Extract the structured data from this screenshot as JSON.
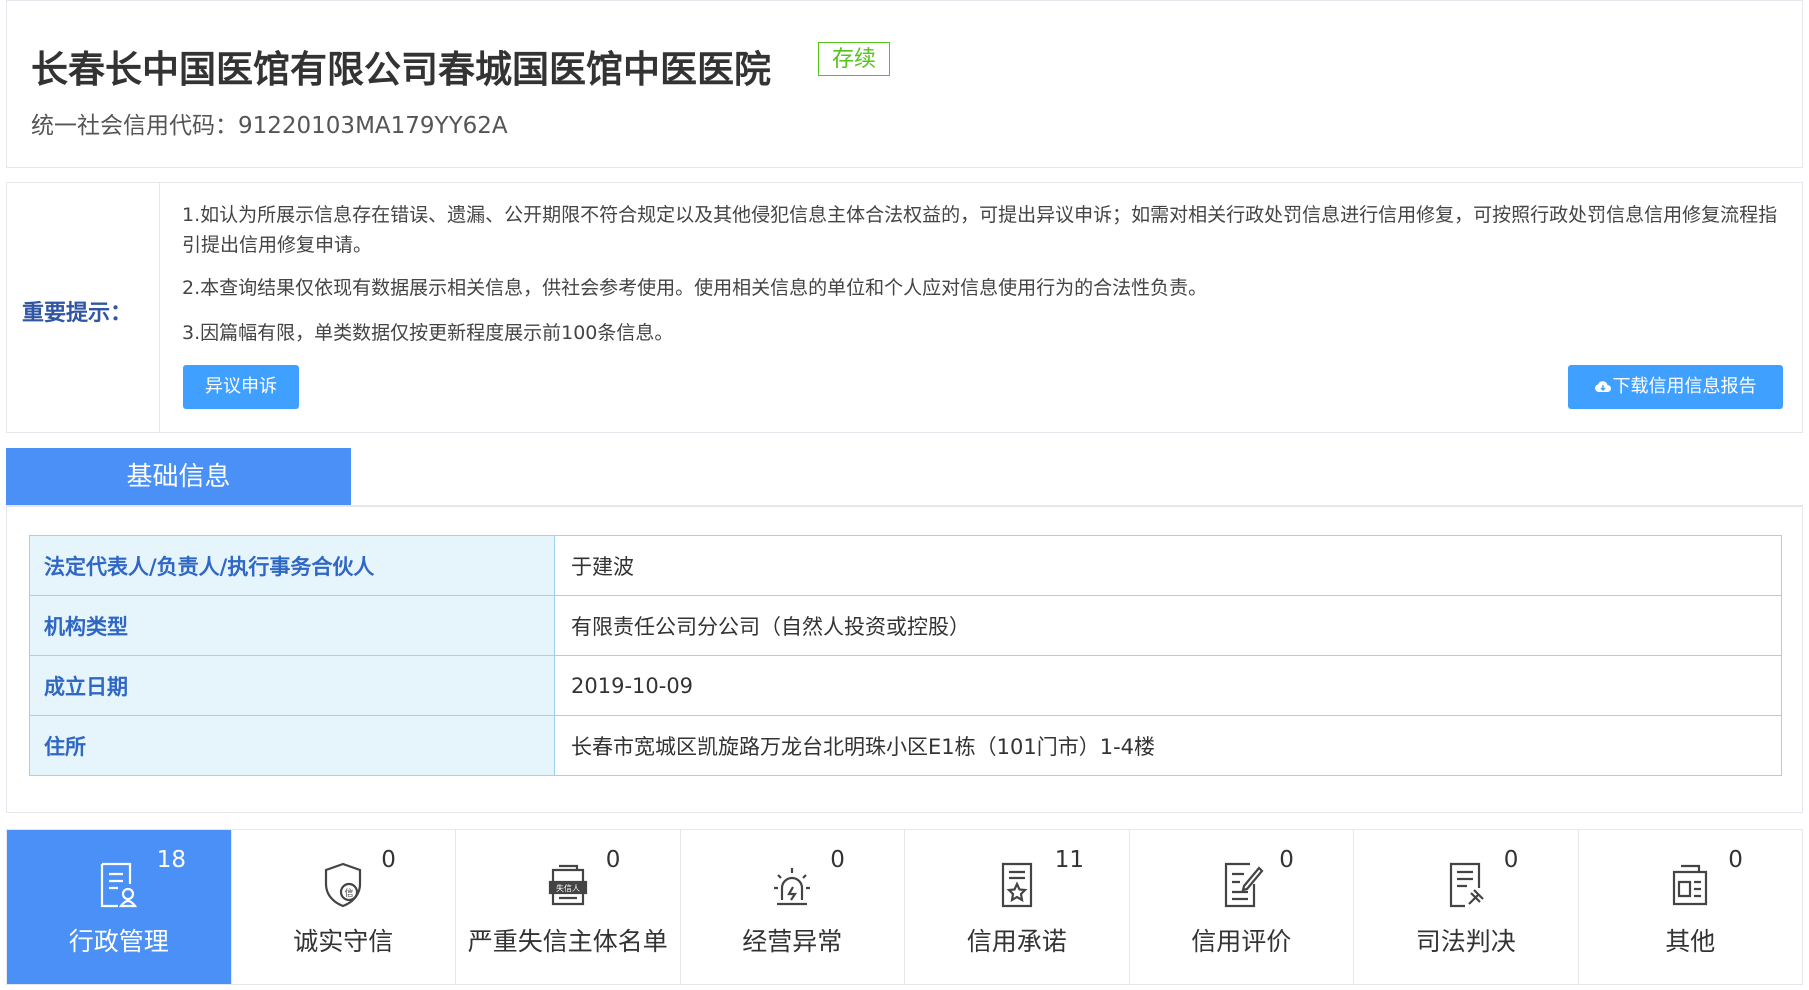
{
  "header": {
    "company_name": "长春长中国医馆有限公司春城国医馆中医医院",
    "status_badge": "存续",
    "credit_code_label": "统一社会信用代码：91220103MA179YY62A"
  },
  "notice": {
    "label": "重要提示：",
    "line1": "1.如认为所展示信息存在错误、遗漏、公开期限不符合规定以及其他侵犯信息主体合法权益的，可提出异议申诉；如需对相关行政处罚信息进行信用修复，可按照行政处罚信息信用修复流程指引提出信用修复申请。",
    "line2": "2.本查询结果仅依现有数据展示相关信息，供社会参考使用。使用相关信息的单位和个人应对信息使用行为的合法性负责。",
    "line3": "3.因篇幅有限，单类数据仅按更新程度展示前100条信息。",
    "appeal_button": "异议申诉",
    "download_button": "下载信用信息报告"
  },
  "basic_tab": "基础信息",
  "info": [
    {
      "key": "法定代表人/负责人/执行事务合伙人",
      "value": "于建波"
    },
    {
      "key": "机构类型",
      "value": "有限责任公司分公司（自然人投资或控股）"
    },
    {
      "key": "成立日期",
      "value": "2019-10-09"
    },
    {
      "key": "住所",
      "value": "长春市宽城区凯旋路万龙台北明珠小区E1栋（101门市）1-4楼"
    }
  ],
  "categories": [
    {
      "label": "行政管理",
      "count": "18",
      "icon": "admin-doc-icon",
      "active": true
    },
    {
      "label": "诚实守信",
      "count": "0",
      "icon": "shield-credit-icon",
      "active": false
    },
    {
      "label": "严重失信主体名单",
      "count": "0",
      "icon": "blacklist-icon",
      "active": false
    },
    {
      "label": "经营异常",
      "count": "0",
      "icon": "alarm-icon",
      "active": false
    },
    {
      "label": "信用承诺",
      "count": "11",
      "icon": "commitment-icon",
      "active": false
    },
    {
      "label": "信用评价",
      "count": "0",
      "icon": "evaluation-icon",
      "active": false
    },
    {
      "label": "司法判决",
      "count": "0",
      "icon": "judgment-icon",
      "active": false
    },
    {
      "label": "其他",
      "count": "0",
      "icon": "other-icon",
      "active": false
    }
  ],
  "colors": {
    "accent": "#4a90f7",
    "button": "#40a0ff",
    "status": "#52c41a",
    "key_text": "#2f67c4",
    "key_bg": "#e6f4fb"
  }
}
